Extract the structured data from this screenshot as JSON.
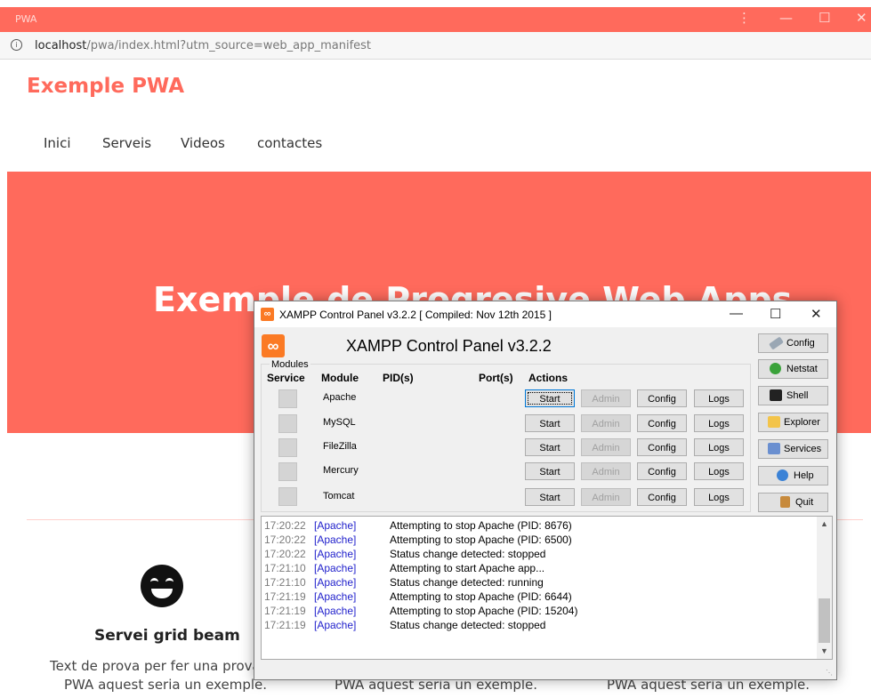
{
  "browser": {
    "title": "PWA",
    "menu_icon": "more-vert-icon",
    "minimize_glyph": "—",
    "maximize_glyph": "☐",
    "close_glyph": "✕",
    "url_host": "localhost",
    "url_path": "/pwa/index.html?utm_source=web_app_manifest",
    "accent_color": "#ff6a5c"
  },
  "site": {
    "brand": "Exemple PWA",
    "nav": [
      "Inici",
      "Serveis",
      "Videos",
      "contactes"
    ],
    "hero_title": "Exemple de Progresive Web Apps",
    "card": {
      "icon": "grinning-face-icon",
      "title": "Servei grid beam",
      "text_line1": "Text de prova per fer una prova",
      "text_line2": "PWA aquest seria un exemple."
    },
    "card2_text_line2": "PWA aquest seria un exemple.",
    "card3_text_line2": "PWA aquest seria un exemple."
  },
  "xampp": {
    "window_title": "XAMPP Control Panel v3.2.2   [ Compiled: Nov 12th 2015 ]",
    "heading": "XAMPP Control Panel v3.2.2",
    "modules_label": "Modules",
    "columns": {
      "service": "Service",
      "module": "Module",
      "pid": "PID(s)",
      "port": "Port(s)",
      "actions": "Actions"
    },
    "modules": [
      "Apache",
      "MySQL",
      "FileZilla",
      "Mercury",
      "Tomcat"
    ],
    "buttons": {
      "start": "Start",
      "admin": "Admin",
      "config": "Config",
      "logs": "Logs"
    },
    "side_buttons": [
      {
        "label": "Config",
        "icon": "wrench-icon"
      },
      {
        "label": "Netstat",
        "icon": "globe-icon"
      },
      {
        "label": "Shell",
        "icon": "terminal-icon"
      },
      {
        "label": "Explorer",
        "icon": "folder-icon"
      },
      {
        "label": "Services",
        "icon": "services-icon"
      },
      {
        "label": "Help",
        "icon": "help-icon"
      },
      {
        "label": "Quit",
        "icon": "quit-icon"
      }
    ],
    "log": [
      {
        "time": "17:20:22",
        "module": "[Apache]",
        "message": "Attempting to stop Apache (PID: 8676)"
      },
      {
        "time": "17:20:22",
        "module": "[Apache]",
        "message": "Attempting to stop Apache (PID: 6500)"
      },
      {
        "time": "17:20:22",
        "module": "[Apache]",
        "message": "Status change detected: stopped"
      },
      {
        "time": "17:21:10",
        "module": "[Apache]",
        "message": "Attempting to start Apache app..."
      },
      {
        "time": "17:21:10",
        "module": "[Apache]",
        "message": "Status change detected: running"
      },
      {
        "time": "17:21:19",
        "module": "[Apache]",
        "message": "Attempting to stop Apache (PID: 6644)"
      },
      {
        "time": "17:21:19",
        "module": "[Apache]",
        "message": "Attempting to stop Apache (PID: 15204)"
      },
      {
        "time": "17:21:19",
        "module": "[Apache]",
        "message": "Status change detected: stopped"
      }
    ]
  }
}
